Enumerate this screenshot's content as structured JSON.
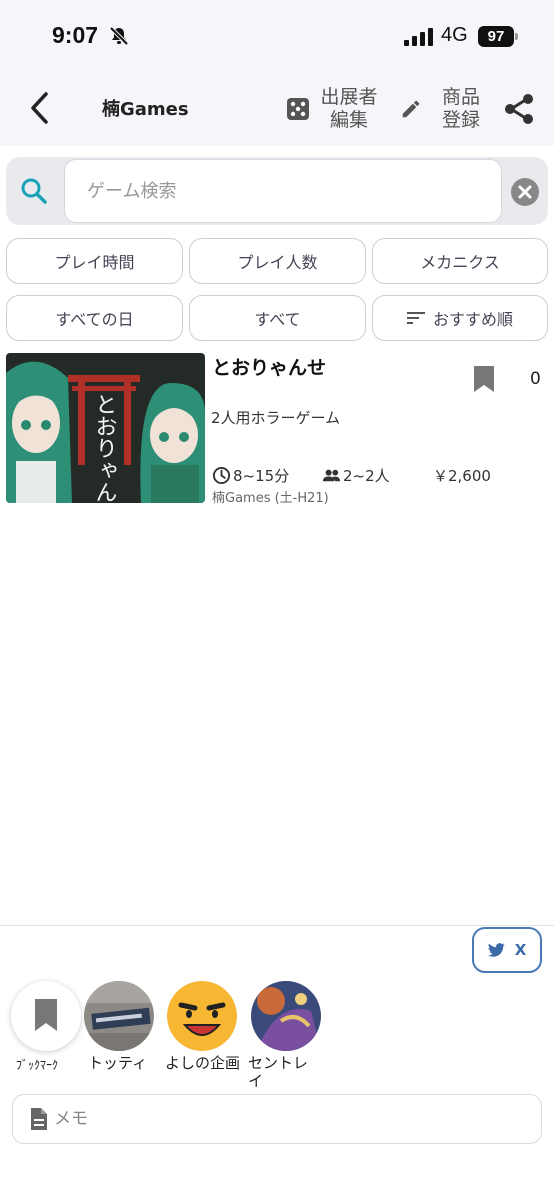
{
  "status_bar": {
    "time": "9:07",
    "network": "4G",
    "battery": "97"
  },
  "header": {
    "title": "楠Games",
    "exhibitor_edit_line1": "出展者",
    "exhibitor_edit_line2": "編集",
    "product_register_line1": "商品",
    "product_register_line2": "登録"
  },
  "search": {
    "placeholder": "ゲーム検索",
    "value": ""
  },
  "filters": {
    "row1": [
      "プレイ時間",
      "プレイ人数",
      "メカニクス"
    ],
    "row2": [
      "すべての日",
      "すべて",
      "おすすめ順"
    ]
  },
  "result": {
    "title": "とおりゃんせ",
    "bookmark_count": "0",
    "description": "2人用ホラーゲーム",
    "play_time": "8~15分",
    "players": "2~2人",
    "price": "￥2,600",
    "booth": "楠Games (土-H21)",
    "thumb_text": "とおりゃんせ"
  },
  "share_x": {
    "label": "X"
  },
  "bottom_avatars": [
    {
      "label": "ﾌﾞｯｸﾏｰｸ"
    },
    {
      "label": "トッティ"
    },
    {
      "label": "よしの企画"
    },
    {
      "label": "セントレイ"
    }
  ],
  "memo": {
    "placeholder": "メモ"
  },
  "colors": {
    "accent": "#1aa3b8",
    "link_blue": "#3a6aa8",
    "chip_border": "#c9cfd8"
  }
}
